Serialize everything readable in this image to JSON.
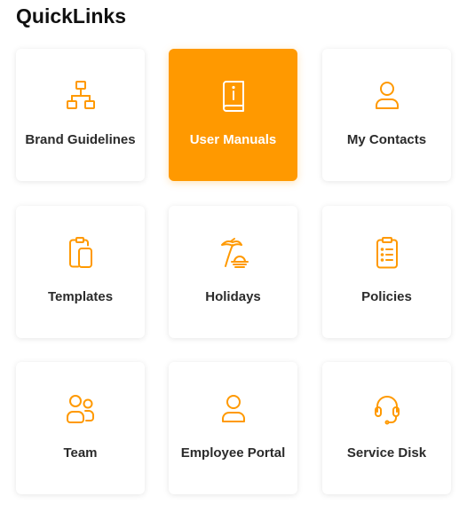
{
  "title": "QuickLinks",
  "accent_color": "#ff9900",
  "tiles": [
    {
      "label": "Brand Guidelines",
      "icon": "sitemap-icon",
      "active": false
    },
    {
      "label": "User Manuals",
      "icon": "manual-book-icon",
      "active": true
    },
    {
      "label": "My Contacts",
      "icon": "user-icon",
      "active": false
    },
    {
      "label": "Templates",
      "icon": "templates-icon",
      "active": false
    },
    {
      "label": "Holidays",
      "icon": "beach-umbrella-icon",
      "active": false
    },
    {
      "label": "Policies",
      "icon": "clipboard-list-icon",
      "active": false
    },
    {
      "label": "Team",
      "icon": "team-icon",
      "active": false
    },
    {
      "label": "Employee Portal",
      "icon": "user-icon",
      "active": false
    },
    {
      "label": "Service Disk",
      "icon": "headset-icon",
      "active": false
    }
  ]
}
